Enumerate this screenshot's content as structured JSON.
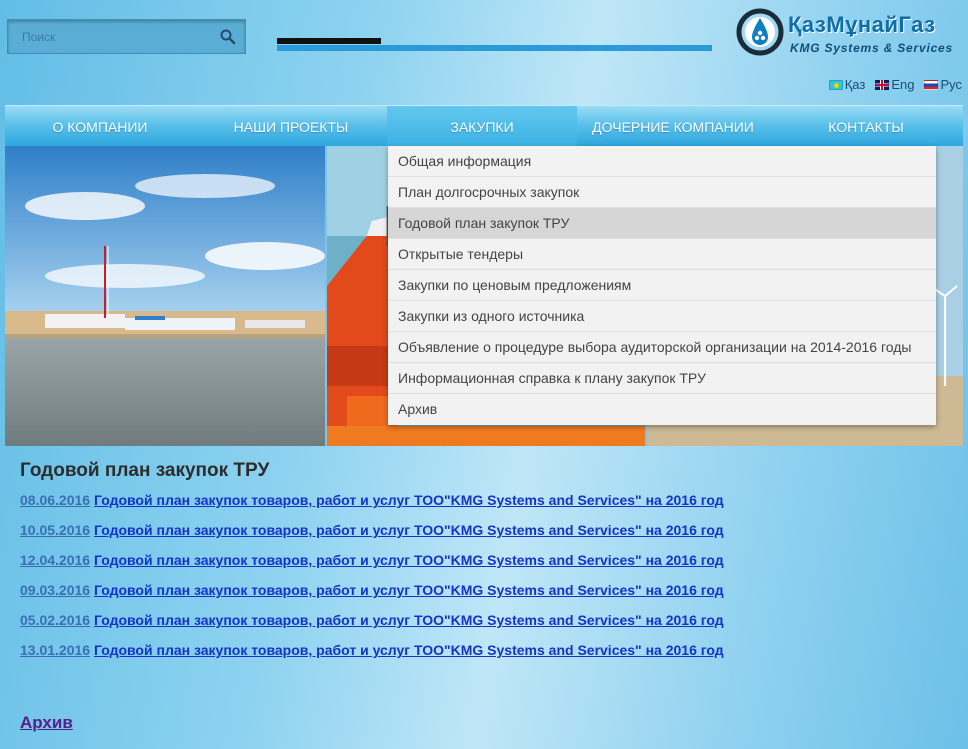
{
  "search": {
    "placeholder": "Поиск"
  },
  "logo": {
    "title": "ҚазМұнайГаз",
    "subtitle": "KMG Systems & Services"
  },
  "languages": [
    {
      "label": "Қаз"
    },
    {
      "label": "Eng"
    },
    {
      "label": "Рус"
    }
  ],
  "nav": [
    {
      "label": "О КОМПАНИИ"
    },
    {
      "label": "НАШИ ПРОЕКТЫ"
    },
    {
      "label": "ЗАКУПКИ"
    },
    {
      "label": "ДОЧЕРНИЕ КОМПАНИИ"
    },
    {
      "label": "КОНТАКТЫ"
    }
  ],
  "dropdown": [
    {
      "label": "Общая информация"
    },
    {
      "label": "План долгосрочных закупок"
    },
    {
      "label": "Годовой план закупок ТРУ"
    },
    {
      "label": "Открытые тендеры"
    },
    {
      "label": "Закупки по ценовым предложениям"
    },
    {
      "label": "Закупки из одного источника"
    },
    {
      "label": "Объявление о процедуре выбора аудиторской организации на 2014-2016 годы"
    },
    {
      "label": "Информационная справка к плану закупок ТРУ"
    },
    {
      "label": "Архив"
    }
  ],
  "content": {
    "title": "Годовой план закупок ТРУ",
    "documents": [
      {
        "date": "08.06.2016",
        "title": "Годовой план закупок товаров, работ и услуг ТОО\"KMG Systems and Services\" на 2016 год"
      },
      {
        "date": "10.05.2016",
        "title": "Годовой план закупок товаров, работ и услуг ТОО\"KMG Systems and Services\" на 2016 год"
      },
      {
        "date": "12.04.2016",
        "title": "Годовой план закупок товаров, работ и услуг ТОО\"KMG Systems and Services\" на 2016 год"
      },
      {
        "date": "09.03.2016",
        "title": "Годовой план закупок товаров, работ и услуг ТОО\"KMG Systems and Services\" на 2016 год"
      },
      {
        "date": "05.02.2016",
        "title": "Годовой план закупок товаров, работ и услуг ТОО\"KMG Systems and Services\" на 2016 год"
      },
      {
        "date": "13.01.2016",
        "title": "Годовой план закупок товаров, работ и услуг ТОО\"KMG Systems and Services\" на 2016 год"
      }
    ],
    "archive_label": "Архив"
  }
}
